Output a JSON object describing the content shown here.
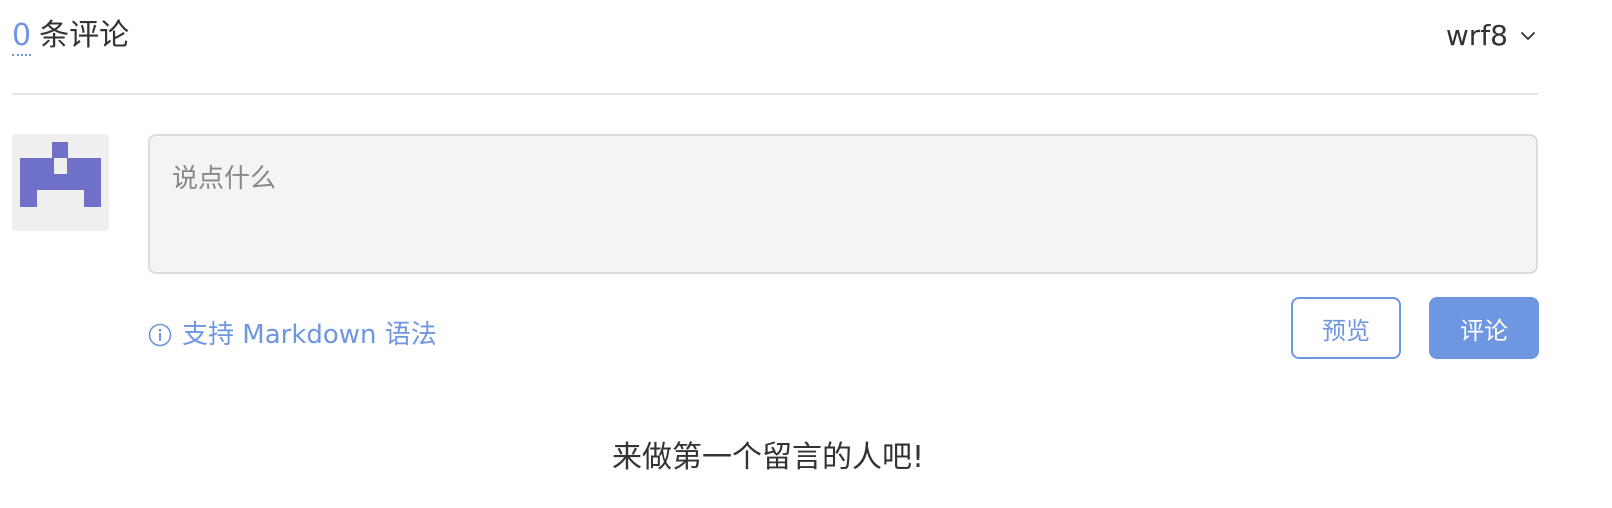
{
  "header": {
    "count": "0",
    "count_label": "条评论",
    "username": "wrf8"
  },
  "icons": {
    "user_menu": "chevron-down-icon",
    "markdown": "info-circle-icon",
    "avatar": "identicon"
  },
  "editor": {
    "placeholder": "说点什么",
    "value": ""
  },
  "markdown_hint": "支持 Markdown 语法",
  "buttons": {
    "preview": "预览",
    "submit": "评论"
  },
  "empty_message": "来做第一个留言的人吧!",
  "colors": {
    "accent": "#6e96e1",
    "avatar_fill": "#6f70c7",
    "avatar_bg": "#efefef"
  }
}
